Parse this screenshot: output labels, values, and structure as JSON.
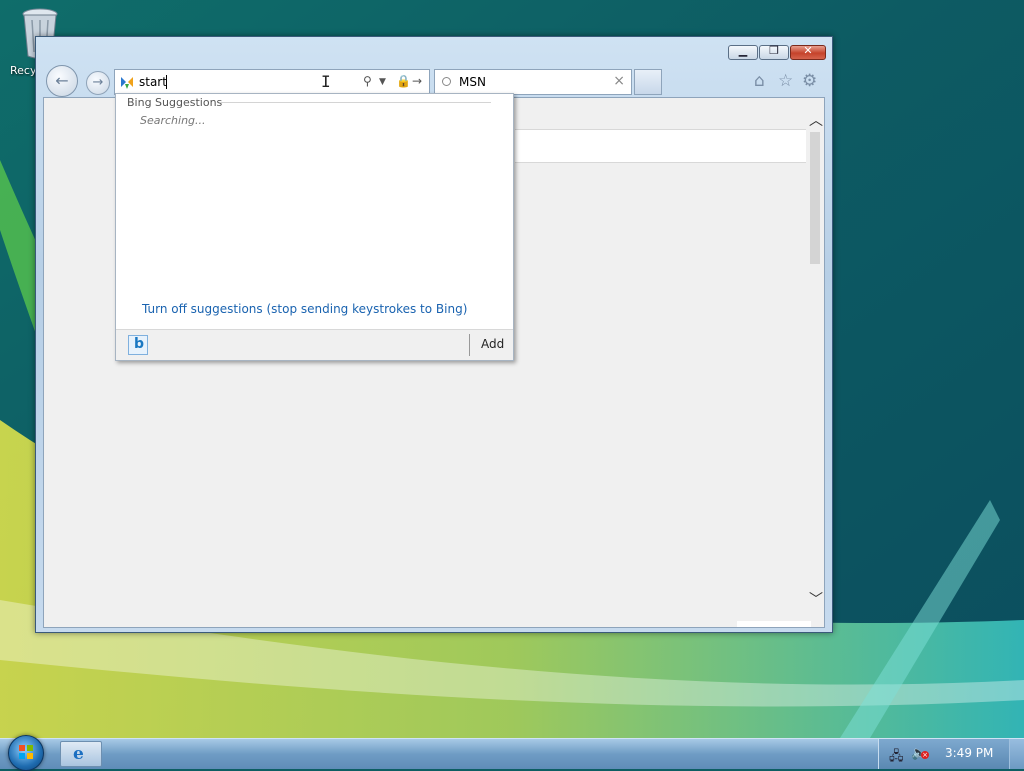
{
  "desktop": {
    "recycle_bin_label": "Recy"
  },
  "browser": {
    "address_value": "start",
    "tab_title": "MSN",
    "suggestions": {
      "heading": "Bing Suggestions",
      "status": "Searching...",
      "turn_off_link": "Turn off suggestions (stop sending keystrokes to Bing)",
      "provider_icon": "bing-icon",
      "add_label": "Add"
    },
    "icons": [
      "back-arrow-icon",
      "forward-arrow-icon",
      "search-icon",
      "lock-icon",
      "go-arrow-icon",
      "home-icon",
      "favorites-star-icon",
      "tools-gear-icon"
    ]
  },
  "taskbar": {
    "clock": "3:49 PM"
  },
  "colors": {
    "link": "#1a63b0",
    "close_button": "#c5432b"
  }
}
